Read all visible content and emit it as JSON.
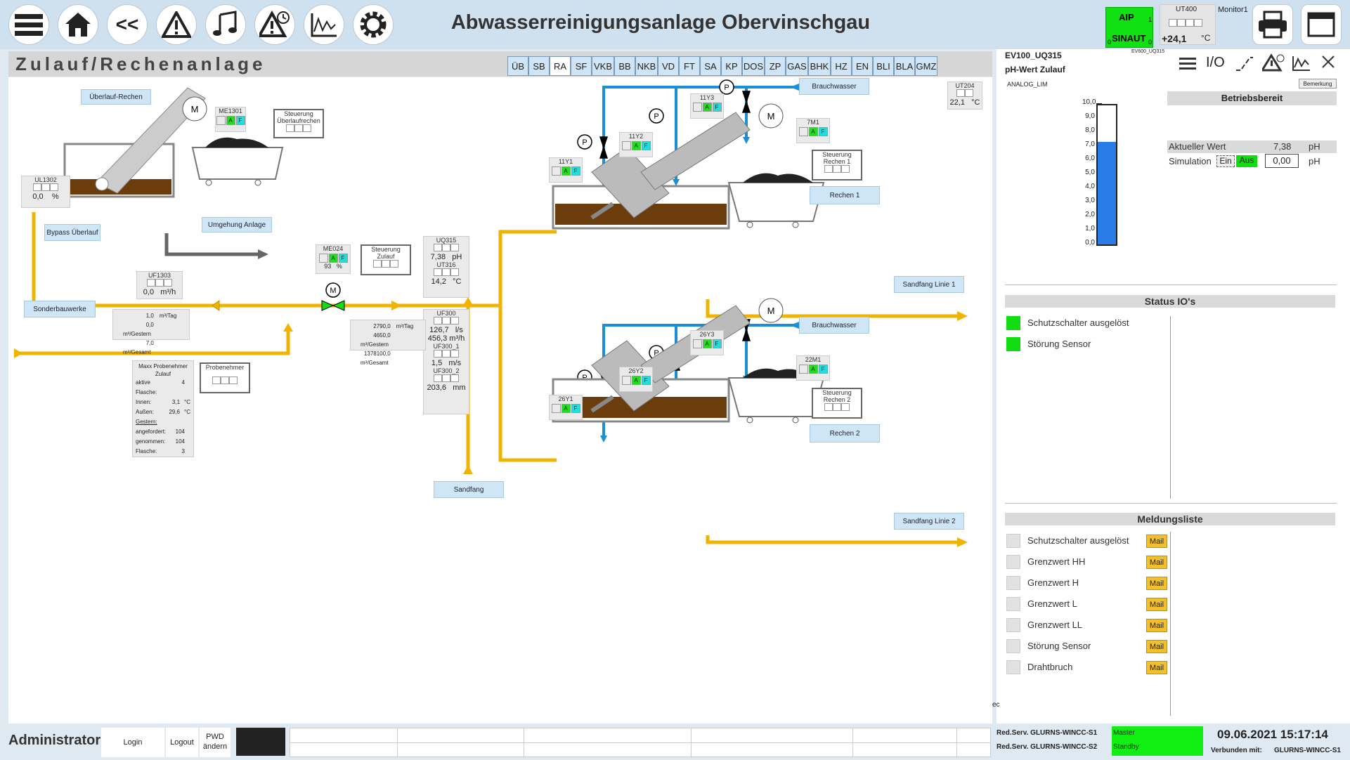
{
  "header": {
    "title": "Abwasserreinigungsanlage Obervinschgau",
    "status_aip": "AIP",
    "status_sinaut": "SINAUT",
    "status_aip_num": "1",
    "status_sinaut_left": "0",
    "status_sinaut_right": "0",
    "ut400_label": "UT400",
    "ut400_value": "+24,1",
    "ut400_unit": "°C",
    "monitor_label": "Monitor1",
    "icons": [
      "menu-icon",
      "home-icon",
      "back-icon",
      "warning-icon",
      "music-icon",
      "warning-clock-icon",
      "trend-icon",
      "gear-icon",
      "printer-icon",
      "window-icon"
    ],
    "back_label": "<<"
  },
  "subheader": {
    "page_title": "Zulauf/Rechenanlage",
    "tabs": [
      "ÜB",
      "SB",
      "RA",
      "SF",
      "VKB",
      "BB",
      "NKB",
      "VD",
      "FT",
      "SA",
      "KP",
      "DOS",
      "ZP",
      "GAS",
      "BHK",
      "HZ",
      "EN",
      "BLI",
      "BLA",
      "GMZ"
    ],
    "active_tab": "RA"
  },
  "process": {
    "labels": {
      "ueberlauf_rechen": "Überlauf-Rechen",
      "bypass": "Bypass Überlauf",
      "umgehung": "Umgehung Anlage",
      "sonderbauwerke": "Sonderbauwerke",
      "sandfang": "Sandfang",
      "brauchwasser1": "Brauchwasser",
      "brauchwasser2": "Brauchwasser",
      "rechen1": "Rechen 1",
      "rechen2": "Rechen 2",
      "sandfang_linie1": "Sandfang Linie 1",
      "sandfang_linie2": "Sandfang Linie 2",
      "steuerung_ueberlauf": "Steuerung Überlaufrechen",
      "steuerung_zulauf": "Steuerung Zulauf",
      "steuerung_rechen1": "Steuerung Rechen 1",
      "steuerung_rechen2": "Steuerung Rechen 2",
      "probenehmer": "Probenehmer",
      "motor": "M",
      "pump": "P"
    },
    "tags": {
      "me1301": "ME1301",
      "ul1302": "UL1302",
      "ul1302_val": "0,0",
      "ul1302_unit": "%",
      "uf1303": "UF1303",
      "uf1303_val": "0,0",
      "uf1303_unit": "m³/h",
      "me024": "ME024",
      "me024_val": "93",
      "me024_unit": "%",
      "uq315": "UQ315",
      "uq315_val": "7,38",
      "uq315_unit": "pH",
      "ut316": "UT316",
      "ut316_val": "14,2",
      "ut316_unit": "°C",
      "uf300": "UF300",
      "uf300_val1": "126,7",
      "uf300_unit1": "l/s",
      "uf300_val2": "456,3",
      "uf300_unit2": "m³/h",
      "uf300_1": "UF300_1",
      "uf300_1_val": "1,5",
      "uf300_1_unit": "m/s",
      "uf300_2": "UF300_2",
      "uf300_2_val": "203,6",
      "uf300_2_unit": "mm",
      "ut204": "UT204",
      "ut204_val": "22,1",
      "ut204_unit": "°C",
      "y11_1": "11Y1",
      "y11_2": "11Y2",
      "y11_3": "11Y3",
      "m7": "7M1",
      "y26_1": "26Y1",
      "y26_2": "26Y2",
      "y26_3": "26Y3",
      "m22": "22M1",
      "a": "A",
      "f": "F"
    },
    "bypass_counts": [
      {
        "v": "1,0",
        "u": "m³/Tag"
      },
      {
        "v": "0,0",
        "u": "m³/Gestern"
      },
      {
        "v": "7,0",
        "u": "m³/Gesamt"
      }
    ],
    "flow_counts": [
      {
        "v": "2790,0",
        "u": "m³/Tag"
      },
      {
        "v": "4650,0",
        "u": "m³/Gestern"
      },
      {
        "v": "1378100,0",
        "u": "m³/Gesamt"
      }
    ],
    "sampler": {
      "title": "Maxx Probenehmer Zulauf",
      "rows": [
        {
          "k": "aktive Flasche:",
          "v": "4",
          "u": ""
        },
        {
          "k": "Innen:",
          "v": "3,1",
          "u": "°C"
        },
        {
          "k": "Außen:",
          "v": "29,6",
          "u": "°C"
        }
      ],
      "gestern": "Gestern:",
      "rows2": [
        {
          "k": "angefordert:",
          "v": "104"
        },
        {
          "k": "genommen:",
          "v": "104"
        },
        {
          "k": "Flasche:",
          "v": "3"
        }
      ]
    }
  },
  "panel": {
    "code": "EV100_UQ315",
    "code_small": "EV600_UQ315",
    "subtitle": "pH-Wert Zulauf",
    "icons": [
      "menu-icon",
      "io-icon",
      "ramp-icon",
      "warning-clock-icon",
      "trend-icon",
      "close-icon"
    ],
    "io_label": "I/O",
    "analog": "ANALOG_LIM",
    "bemerkung": "Bemerkung",
    "ready": "Betriebsbereit",
    "scale": [
      "10,0",
      "9,0",
      "8,0",
      "7,0",
      "6,0",
      "5,0",
      "4,0",
      "3,0",
      "2,0",
      "1,0",
      "0,0"
    ],
    "level_fraction": 0.738,
    "aktueller_label": "Aktueller Wert",
    "aktueller_val": "7,38",
    "unit": "pH",
    "sim_label": "Simulation",
    "sim_ein": "Ein",
    "sim_aus": "Aus",
    "sim_val": "0,00",
    "status_header": "Status IO's",
    "status_items": [
      "Schutzschalter ausgelöst",
      "Störung Sensor"
    ],
    "meld_header": "Meldungsliste",
    "meld_items": [
      "Schutzschalter ausgelöst",
      "Grenzwert HH",
      "Grenzwert H",
      "Grenzwert L",
      "Grenzwert LL",
      "Störung Sensor",
      "Drahtbruch"
    ],
    "mail": "Mail"
  },
  "footer": {
    "user": "Administrator",
    "login": "Login",
    "logout": "Logout",
    "pwd": "PWD ändern",
    "server1": "Red.Serv. GLURNS-WINCC-S1",
    "server2": "Red.Serv. GLURNS-WINCC-S2",
    "master": "Master",
    "standby": "Standby",
    "datetime": "09.06.2021 15:17:14",
    "connected_label": "Verbunden mit:",
    "connected_val": "GLURNS-WINCC-S1",
    "ec": "ec"
  },
  "colors": {
    "pipe_yellow": "#f0b400",
    "pipe_blue": "#1a8fd8",
    "green": "#11dd11",
    "mail": "#f2c02a"
  }
}
